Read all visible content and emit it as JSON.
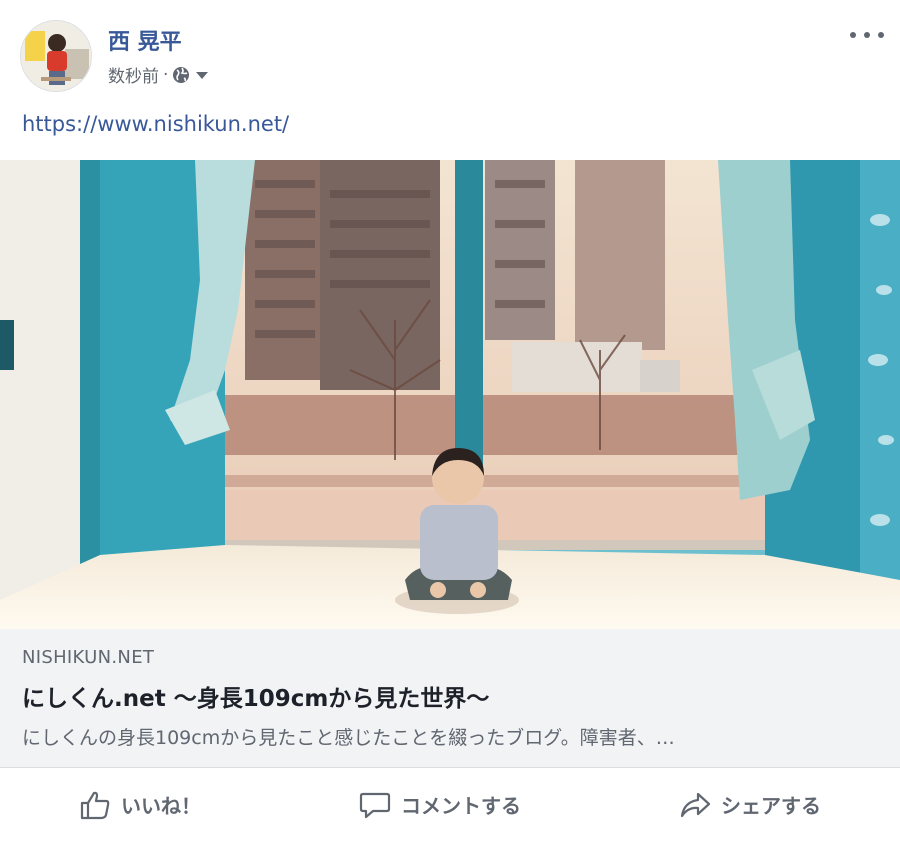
{
  "header": {
    "author_name": "西 晃平",
    "timestamp": "数秒前",
    "separator": "·",
    "privacy_icon": "globe-icon",
    "privacy_dropdown_icon": "caret-down-icon",
    "more_icon": "more-horizontal-icon"
  },
  "post": {
    "link_text": "https://www.nishikun.net/"
  },
  "link_preview": {
    "domain": "NISHIKUN.NET",
    "title": "にしくん.net 〜身長109cmから見た世界〜",
    "description": "にしくんの身長109cmから見たこと感じたことを綴ったブログ。障害者、…"
  },
  "actions": {
    "like": {
      "label": "いいね！",
      "icon": "thumbs-up-icon"
    },
    "comment": {
      "label": "コメントする",
      "icon": "comment-bubble-icon"
    },
    "share": {
      "label": "シェアする",
      "icon": "share-arrow-icon"
    }
  },
  "colors": {
    "name_link": "#385898",
    "meta_text": "#606770",
    "preview_bg": "#f2f3f5"
  }
}
